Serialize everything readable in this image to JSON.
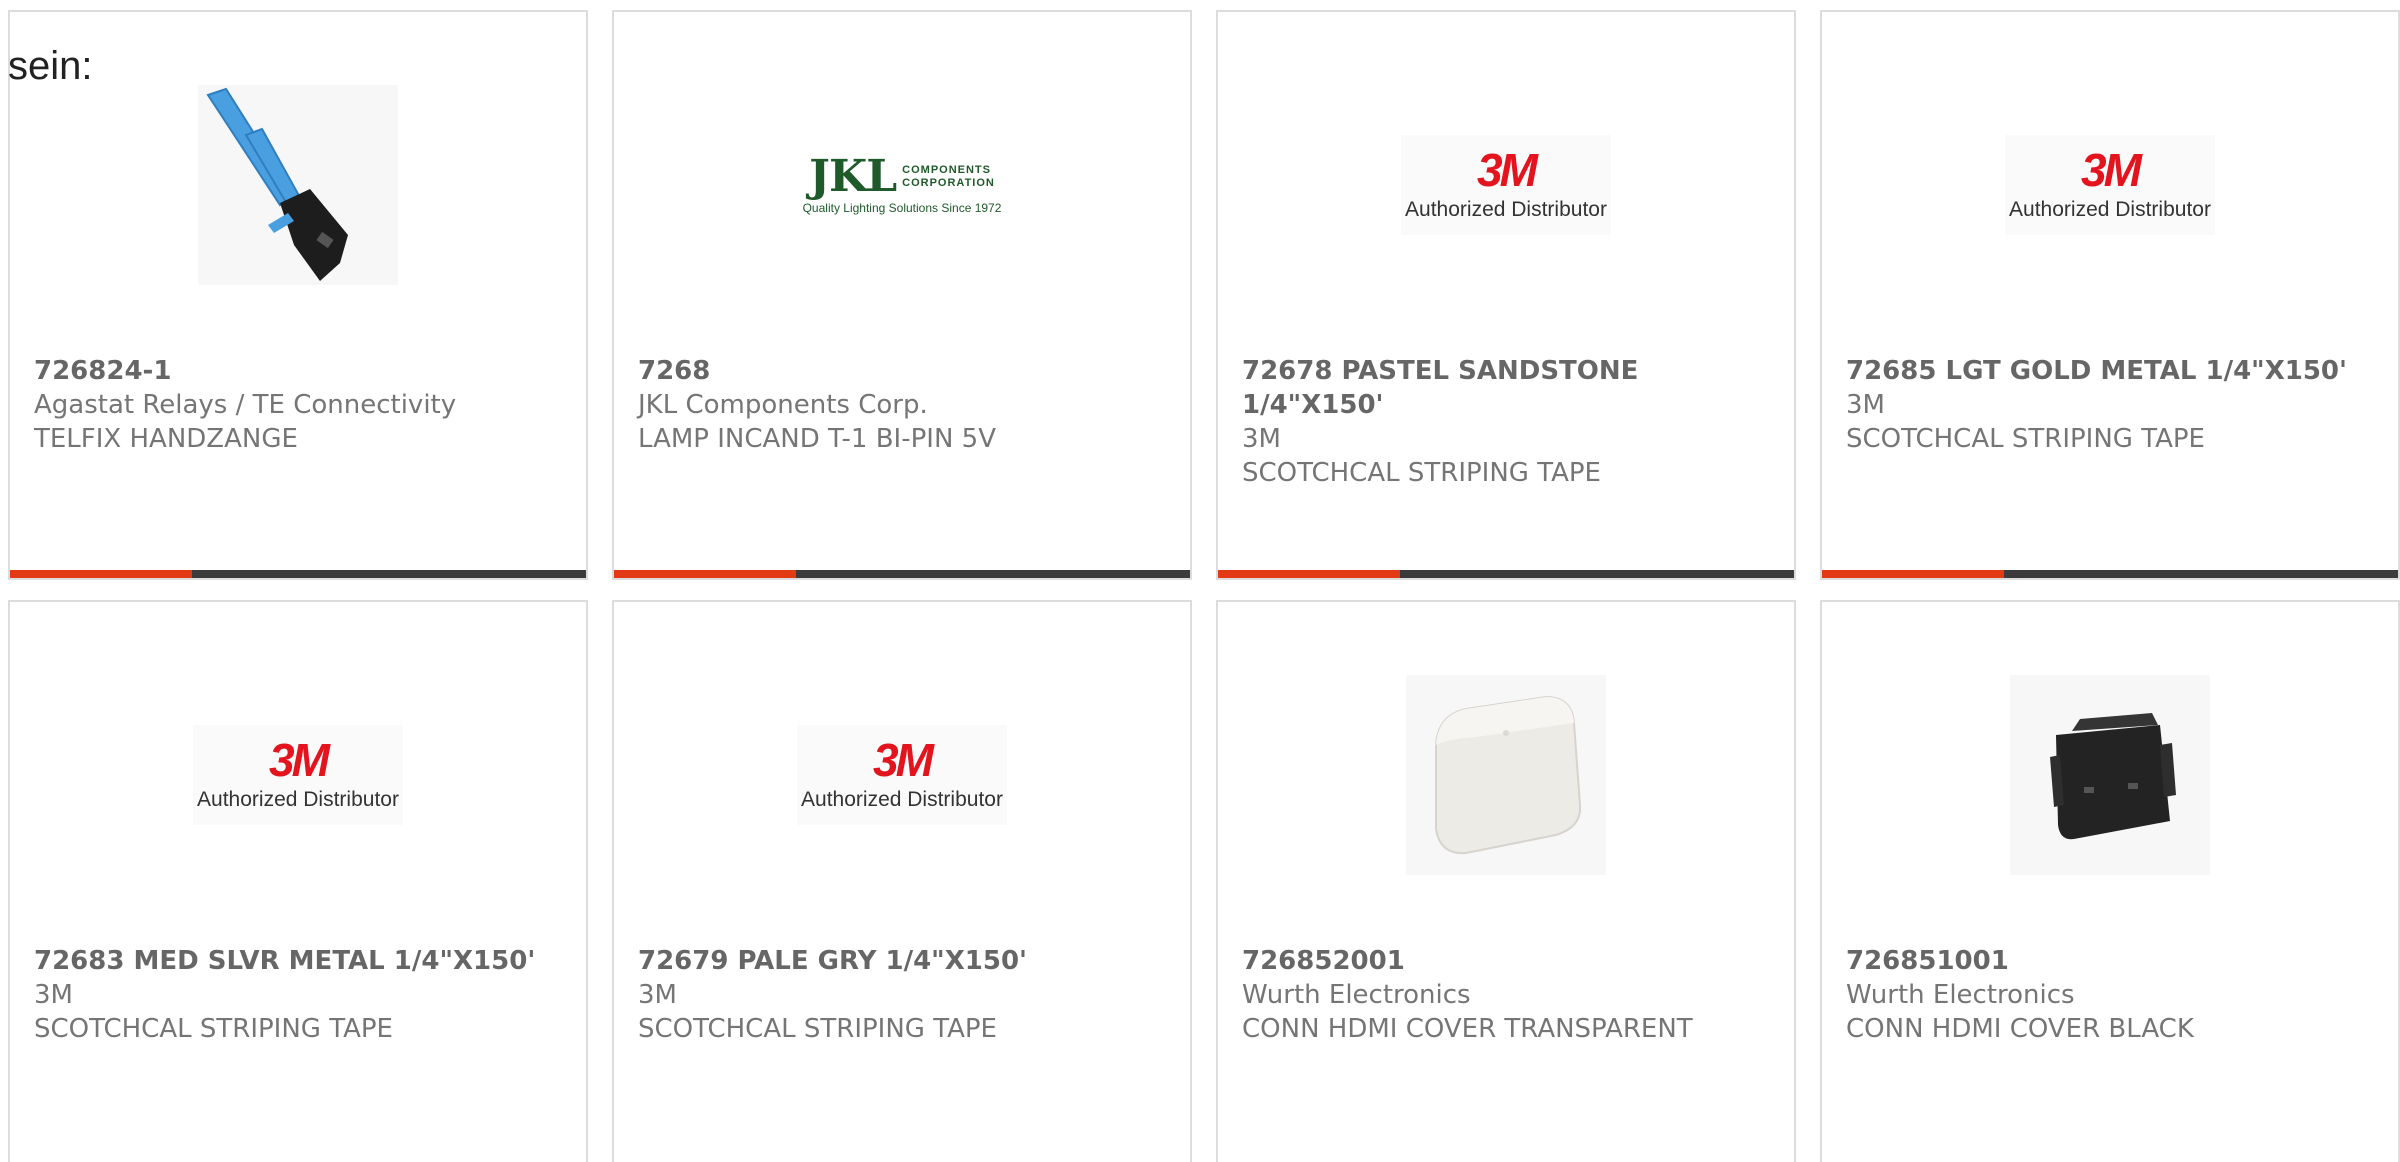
{
  "intro_text": "sein:",
  "colors": {
    "accent_bar": "#e23a14",
    "bar": "#3b3b3b",
    "brand_3m": "#e3141d",
    "jkl_green": "#1f5a2a"
  },
  "products": [
    {
      "part": "726824-1",
      "manufacturer": "Agastat Relays / TE Connectivity",
      "description": "TELFIX HANDZANGE",
      "image": "crimp-tool-photo"
    },
    {
      "part": "7268",
      "manufacturer": "JKL Components Corp.",
      "description": "LAMP INCAND T-1 BI-PIN 5V",
      "image": "jkl-logo",
      "logo": {
        "big": "JKL",
        "line1": "COMPONENTS",
        "line2": "CORPORATION",
        "tagline": "Quality Lighting Solutions Since 1972"
      }
    },
    {
      "part": "72678 PASTEL SANDSTONE 1/4\"X150'",
      "manufacturer": "3M",
      "description": "SCOTCHCAL STRIPING TAPE",
      "image": "3m-logo",
      "logo": {
        "mark": "3M",
        "sub": "Authorized Distributor"
      }
    },
    {
      "part": "72685 LGT GOLD METAL 1/4\"X150'",
      "manufacturer": "3M",
      "description": "SCOTCHCAL STRIPING TAPE",
      "image": "3m-logo",
      "logo": {
        "mark": "3M",
        "sub": "Authorized Distributor"
      }
    },
    {
      "part": "72683 MED SLVR METAL 1/4\"X150'",
      "manufacturer": "3M",
      "description": "SCOTCHCAL STRIPING TAPE",
      "image": "3m-logo",
      "logo": {
        "mark": "3M",
        "sub": "Authorized Distributor"
      }
    },
    {
      "part": "72679 PALE GRY 1/4\"X150'",
      "manufacturer": "3M",
      "description": "SCOTCHCAL STRIPING TAPE",
      "image": "3m-logo",
      "logo": {
        "mark": "3M",
        "sub": "Authorized Distributor"
      }
    },
    {
      "part": "726852001",
      "manufacturer": "Wurth Electronics",
      "description": "CONN HDMI COVER TRANSPARENT",
      "image": "hdmi-cover-transparent-photo"
    },
    {
      "part": "726851001",
      "manufacturer": "Wurth Electronics",
      "description": "CONN HDMI COVER BLACK",
      "image": "hdmi-cover-black-photo"
    }
  ]
}
